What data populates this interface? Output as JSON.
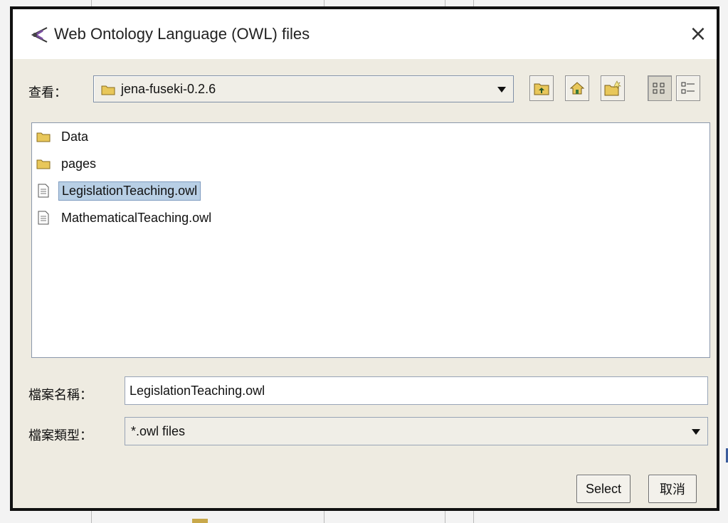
{
  "dialog": {
    "title": "Web Ontology Language (OWL) files",
    "close_symbol": "×"
  },
  "look_in": {
    "label": "查看：",
    "current": "jena-fuseki-0.2.6"
  },
  "toolbar": {
    "icons": [
      "up-folder-icon",
      "home-icon",
      "new-folder-icon",
      "list-view-icon",
      "details-view-icon"
    ]
  },
  "files": [
    {
      "name": "Data",
      "type": "folder",
      "selected": false
    },
    {
      "name": "pages",
      "type": "folder",
      "selected": false
    },
    {
      "name": "LegislationTeaching.owl",
      "type": "file",
      "selected": true
    },
    {
      "name": "MathematicalTeaching.owl",
      "type": "file",
      "selected": false
    }
  ],
  "file_name": {
    "label": "檔案名稱：",
    "value": "LegislationTeaching.owl"
  },
  "file_type": {
    "label": "檔案類型：",
    "value": "*.owl files"
  },
  "buttons": {
    "select": "Select",
    "cancel": "取消"
  },
  "colors": {
    "dialog_bg": "#eeebe1",
    "selection": "#b8cfe5",
    "folder": "#e8c75a"
  }
}
